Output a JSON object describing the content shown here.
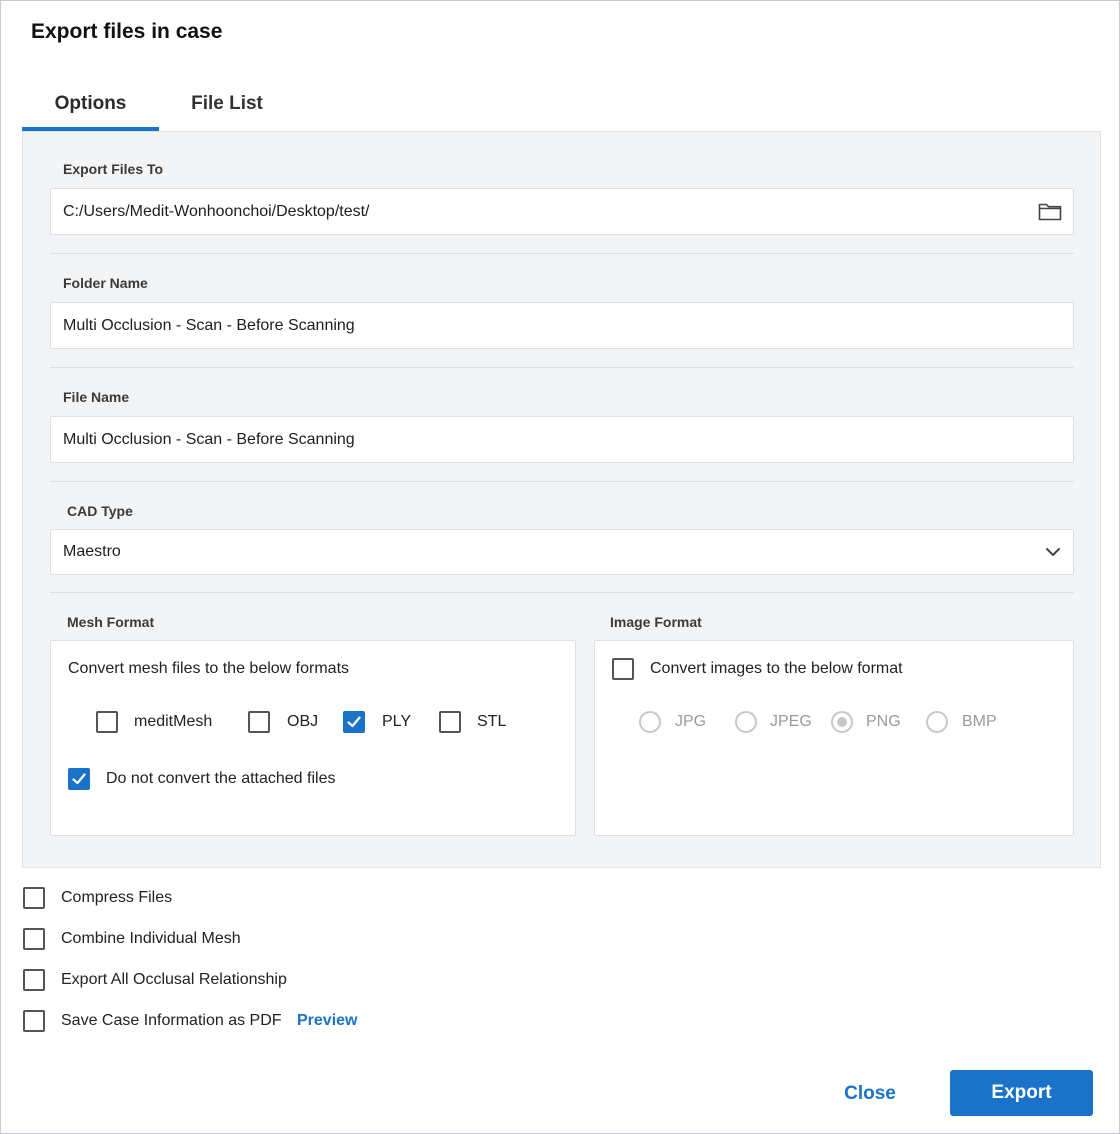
{
  "dialog": {
    "title": "Export files in case"
  },
  "tabs": [
    {
      "label": "Options",
      "active": true
    },
    {
      "label": "File List",
      "active": false
    }
  ],
  "export_to": {
    "label": "Export Files To",
    "value": "C:/Users/Medit-Wonhoonchoi/Desktop/test/",
    "icon": "folder-icon"
  },
  "folder_name": {
    "label": "Folder Name",
    "value": "Multi Occlusion - Scan - Before Scanning"
  },
  "file_name": {
    "label": "File Name",
    "value": "Multi Occlusion - Scan - Before Scanning"
  },
  "cad_type": {
    "label": "CAD Type",
    "value": "Maestro",
    "icon": "chevron-down-icon"
  },
  "mesh_format": {
    "label": "Mesh Format",
    "description": "Convert mesh files to the below formats",
    "options": [
      {
        "label": "meditMesh",
        "checked": false
      },
      {
        "label": "OBJ",
        "checked": false
      },
      {
        "label": "PLY",
        "checked": true
      },
      {
        "label": "STL",
        "checked": false
      }
    ],
    "no_convert": {
      "label": "Do not convert the attached files",
      "checked": true
    }
  },
  "image_format": {
    "label": "Image Format",
    "convert": {
      "label": "Convert images to the below format",
      "checked": false
    },
    "options": [
      {
        "label": "JPG",
        "selected": false
      },
      {
        "label": "JPEG",
        "selected": false
      },
      {
        "label": "PNG",
        "selected": true
      },
      {
        "label": "BMP",
        "selected": false
      }
    ]
  },
  "extra_options": [
    {
      "label": "Compress Files",
      "checked": false
    },
    {
      "label": "Combine Individual Mesh",
      "checked": false
    },
    {
      "label": "Export All Occlusal Relationship",
      "checked": false
    },
    {
      "label": "Save Case Information as PDF",
      "checked": false
    }
  ],
  "preview_link": "Preview",
  "buttons": {
    "close": "Close",
    "export": "Export"
  },
  "colors": {
    "accent": "#1a73c9",
    "panel_bg": "#f2f4f6",
    "disabled": "#9a9a9a"
  }
}
